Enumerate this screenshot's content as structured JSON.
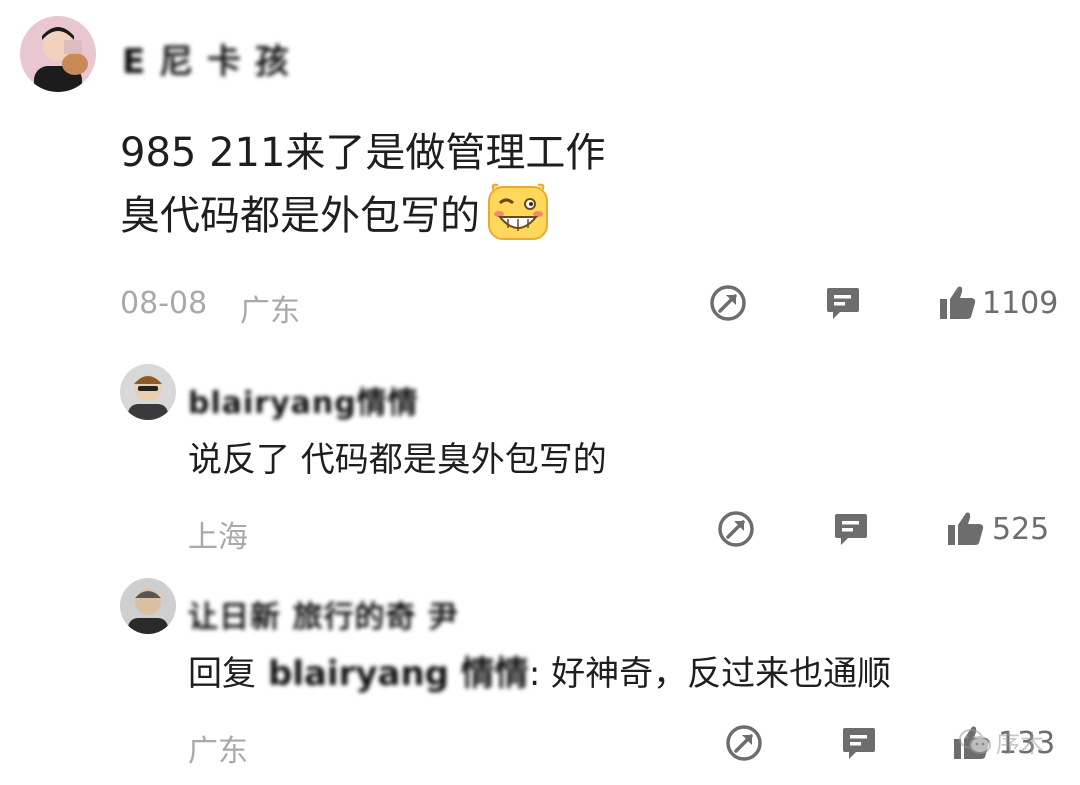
{
  "comment": {
    "username": "E  尼  卡  孩",
    "line1": "985 211来了是做管理工作",
    "line2": "臭代码都是外包写的",
    "date": "08-08",
    "location": "广东",
    "likes": "1109"
  },
  "replies": [
    {
      "username": "blairyang情情",
      "text": "说反了 代码都是臭外包写的",
      "location": "上海",
      "likes": "525"
    },
    {
      "username": "让日新  旅行的奇  尹",
      "reply_prefix": "回复",
      "reply_target": "blairyang 情情",
      "reply_text": ": 好神奇，反过来也通顺",
      "location": "广东",
      "likes": "133"
    }
  ],
  "watermark": {
    "text": "序木"
  },
  "icons": [
    "share-icon",
    "comment-icon",
    "thumbs-up-icon",
    "grin-emoji-icon",
    "wechat-icon"
  ],
  "colors": {
    "meta": "#a9a9a9",
    "icon": "#6d6d6d",
    "text": "#1e1e1e"
  }
}
